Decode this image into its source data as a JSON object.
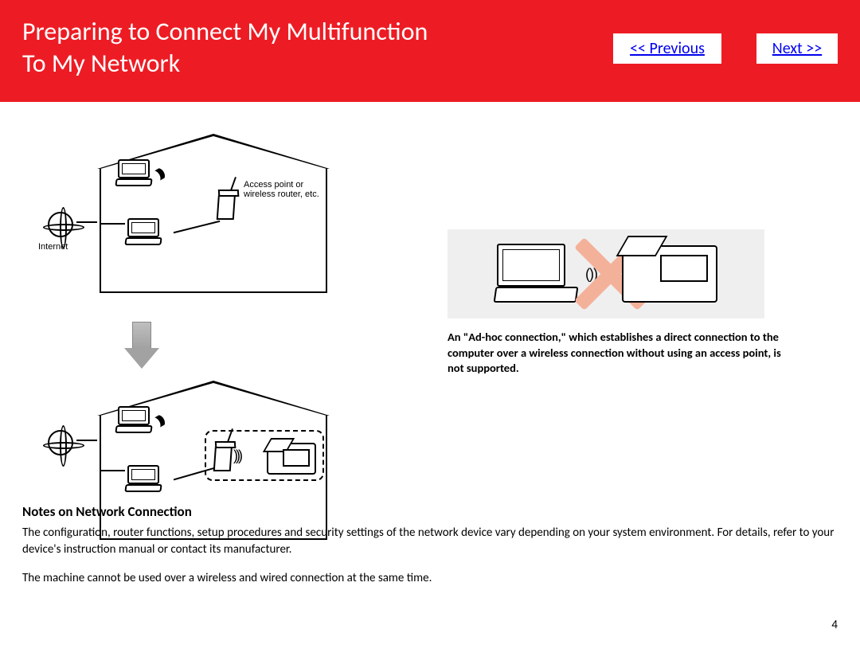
{
  "header": {
    "title_line1": "Preparing to Connect My Multifunction",
    "title_line2": "To My Network",
    "prev_label": "<< Previous",
    "next_label": "Next >>"
  },
  "diagram": {
    "internet_label": "Internet",
    "router_label": "Access point or\nwireless router, etc."
  },
  "adhoc": {
    "caption": "An \"Ad-hoc connection,\" which establishes a direct connection to the computer over a wireless connection without using an access point, is not supported."
  },
  "notes": {
    "heading": "Notes on Network Connection",
    "p1": "The configuration, router functions, setup procedures and security settings of the network device vary depending on your system environment. For details, refer to your device's instruction manual or contact its manufacturer.",
    "p2": "The machine cannot be used over a wireless and wired connection at the same time."
  },
  "page_number": "4"
}
